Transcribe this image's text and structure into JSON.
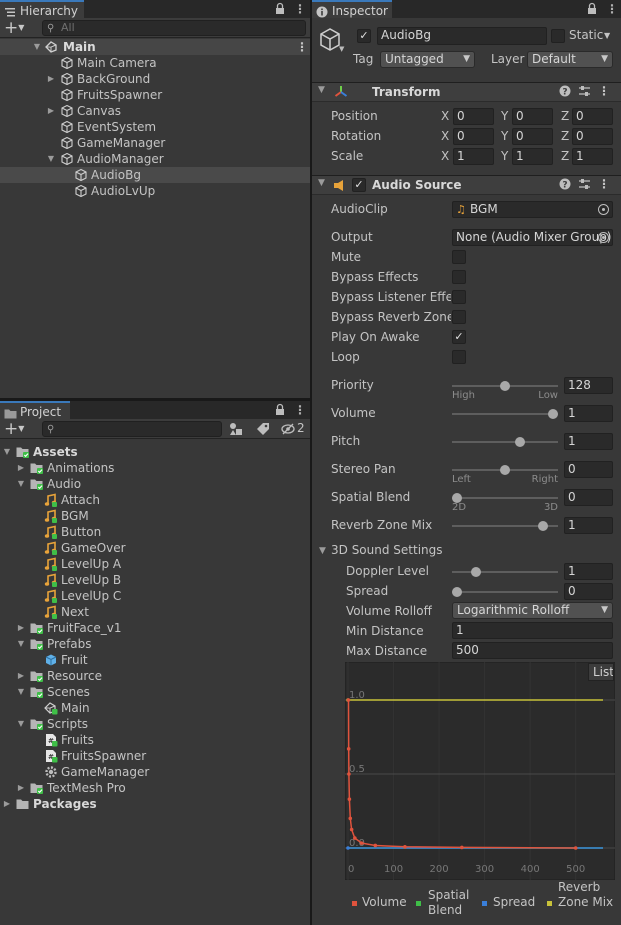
{
  "hierarchy": {
    "tab_label": "Hierarchy",
    "search_placeholder": "All",
    "scene_name": "Main",
    "items": [
      {
        "label": "Main Camera",
        "depth": 1,
        "expand": ""
      },
      {
        "label": "BackGround",
        "depth": 1,
        "expand": "collapsed"
      },
      {
        "label": "FruitsSpawner",
        "depth": 1,
        "expand": ""
      },
      {
        "label": "Canvas",
        "depth": 1,
        "expand": "collapsed"
      },
      {
        "label": "EventSystem",
        "depth": 1,
        "expand": ""
      },
      {
        "label": "GameManager",
        "depth": 1,
        "expand": ""
      },
      {
        "label": "AudioManager",
        "depth": 1,
        "expand": "expanded"
      },
      {
        "label": "AudioBg",
        "depth": 2,
        "expand": "",
        "selected": true
      },
      {
        "label": "AudioLvUp",
        "depth": 2,
        "expand": ""
      }
    ]
  },
  "project": {
    "tab_label": "Project",
    "hidden_count": "2",
    "items": [
      {
        "label": "Assets",
        "depth": 0,
        "expand": "expanded",
        "type": "folder",
        "bold": true
      },
      {
        "label": "Animations",
        "depth": 1,
        "expand": "collapsed",
        "type": "folder"
      },
      {
        "label": "Audio",
        "depth": 1,
        "expand": "expanded",
        "type": "folder"
      },
      {
        "label": "Attach",
        "depth": 2,
        "expand": "",
        "type": "audio"
      },
      {
        "label": "BGM",
        "depth": 2,
        "expand": "",
        "type": "audio"
      },
      {
        "label": "Button",
        "depth": 2,
        "expand": "",
        "type": "audio"
      },
      {
        "label": "GameOver",
        "depth": 2,
        "expand": "",
        "type": "audio"
      },
      {
        "label": "LevelUp A",
        "depth": 2,
        "expand": "",
        "type": "audio"
      },
      {
        "label": "LevelUp B",
        "depth": 2,
        "expand": "",
        "type": "audio"
      },
      {
        "label": "LevelUp C",
        "depth": 2,
        "expand": "",
        "type": "audio"
      },
      {
        "label": "Next",
        "depth": 2,
        "expand": "",
        "type": "audio"
      },
      {
        "label": "FruitFace_v1",
        "depth": 1,
        "expand": "collapsed",
        "type": "folder"
      },
      {
        "label": "Prefabs",
        "depth": 1,
        "expand": "expanded",
        "type": "folder"
      },
      {
        "label": "Fruit",
        "depth": 2,
        "expand": "",
        "type": "prefab"
      },
      {
        "label": "Resource",
        "depth": 1,
        "expand": "collapsed",
        "type": "folder"
      },
      {
        "label": "Scenes",
        "depth": 1,
        "expand": "expanded",
        "type": "folder"
      },
      {
        "label": "Main",
        "depth": 2,
        "expand": "",
        "type": "scene"
      },
      {
        "label": "Scripts",
        "depth": 1,
        "expand": "expanded",
        "type": "folder"
      },
      {
        "label": "Fruits",
        "depth": 2,
        "expand": "",
        "type": "script"
      },
      {
        "label": "FruitsSpawner",
        "depth": 2,
        "expand": "",
        "type": "script"
      },
      {
        "label": "GameManager",
        "depth": 2,
        "expand": "",
        "type": "gear"
      },
      {
        "label": "TextMesh Pro",
        "depth": 1,
        "expand": "collapsed",
        "type": "folder"
      },
      {
        "label": "Packages",
        "depth": 0,
        "expand": "collapsed",
        "type": "folder-plain",
        "bold": true
      }
    ]
  },
  "inspector": {
    "tab_label": "Inspector",
    "object_name": "AudioBg",
    "static_label": "Static",
    "tag_label": "Tag",
    "tag_value": "Untagged",
    "layer_label": "Layer",
    "layer_value": "Default",
    "transform": {
      "title": "Transform",
      "rows": [
        {
          "label": "Position",
          "x": "0",
          "y": "0",
          "z": "0"
        },
        {
          "label": "Rotation",
          "x": "0",
          "y": "0",
          "z": "0"
        },
        {
          "label": "Scale",
          "x": "1",
          "y": "1",
          "z": "1"
        }
      ],
      "axis_x": "X",
      "axis_y": "Y",
      "axis_z": "Z"
    },
    "audio_source": {
      "title": "Audio Source",
      "audio_clip_label": "AudioClip",
      "audio_clip_value": "BGM",
      "output_label": "Output",
      "output_value": "None (Audio Mixer Group)",
      "toggles": [
        {
          "label": "Mute",
          "checked": false
        },
        {
          "label": "Bypass Effects",
          "checked": false
        },
        {
          "label": "Bypass Listener Effects",
          "checked": false
        },
        {
          "label": "Bypass Reverb Zones",
          "checked": false
        },
        {
          "label": "Play On Awake",
          "checked": true
        },
        {
          "label": "Loop",
          "checked": false
        }
      ],
      "priority": {
        "label": "Priority",
        "value": "128",
        "fraction": 0.5,
        "left": "High",
        "right": "Low"
      },
      "volume": {
        "label": "Volume",
        "value": "1",
        "fraction": 1.0
      },
      "pitch": {
        "label": "Pitch",
        "value": "1",
        "fraction": 0.66
      },
      "stereo_pan": {
        "label": "Stereo Pan",
        "value": "0",
        "fraction": 0.5,
        "left": "Left",
        "right": "Right"
      },
      "spatial_blend": {
        "label": "Spatial Blend",
        "value": "0",
        "fraction": 0.0,
        "left": "2D",
        "right": "3D"
      },
      "reverb_zone_mix": {
        "label": "Reverb Zone Mix",
        "value": "1",
        "fraction": 0.9
      }
    },
    "sound3d": {
      "title": "3D Sound Settings",
      "doppler": {
        "label": "Doppler Level",
        "value": "1",
        "fraction": 0.2
      },
      "spread": {
        "label": "Spread",
        "value": "0",
        "fraction": 0.0
      },
      "rolloff_label": "Volume Rolloff",
      "rolloff_value": "Logarithmic Rolloff",
      "min_distance_label": "Min Distance",
      "min_distance_value": "1",
      "max_distance_label": "Max Distance",
      "max_distance_value": "500",
      "listener_button": "Listener"
    }
  },
  "chart_data": {
    "type": "line",
    "title": "",
    "xlabel": "",
    "ylabel": "",
    "xlim": [
      0,
      560
    ],
    "ylim": [
      0,
      1.0
    ],
    "x_ticks": [
      "0",
      "100",
      "200",
      "300",
      "400",
      "500"
    ],
    "y_ticks": [
      "0.0",
      "0.5",
      "1.0"
    ],
    "series": [
      {
        "name": "Volume",
        "color": "#e0533d",
        "x": [
          1,
          1.5,
          2,
          3,
          5,
          8,
          15,
          30,
          60,
          125,
          250,
          500
        ],
        "y": [
          1.0,
          0.67,
          0.5,
          0.33,
          0.2,
          0.125,
          0.067,
          0.033,
          0.017,
          0.008,
          0.004,
          0.0
        ]
      },
      {
        "name": "Spatial Blend",
        "color": "#3fbf48",
        "x": [
          0,
          560
        ],
        "y": [
          0,
          0
        ]
      },
      {
        "name": "Spread",
        "color": "#3a7fd9",
        "x": [
          0,
          560
        ],
        "y": [
          0,
          0
        ]
      },
      {
        "name": "Reverb Zone Mix",
        "color": "#c8c23a",
        "x": [
          0,
          560
        ],
        "y": [
          1.0,
          1.0
        ]
      }
    ]
  }
}
